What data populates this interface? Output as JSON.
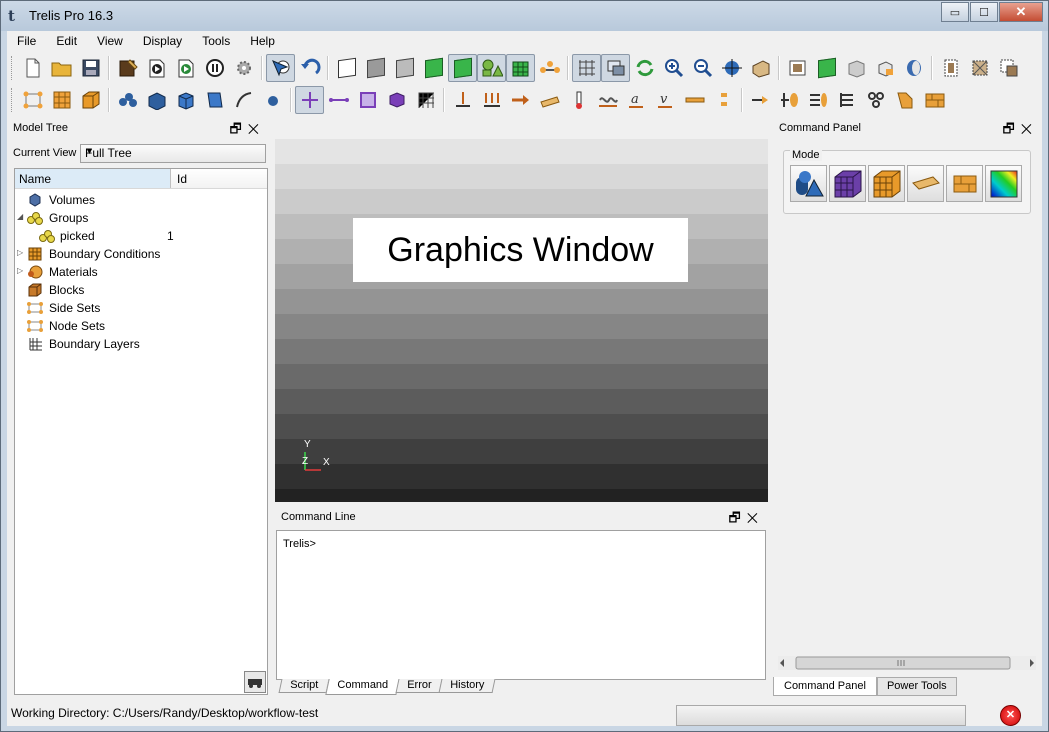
{
  "window": {
    "title": "Trelis Pro  16.3",
    "controls": {
      "minimize": "▭",
      "maximize": "☐",
      "close": "✕"
    }
  },
  "menubar": [
    "File",
    "Edit",
    "View",
    "Display",
    "Tools",
    "Help"
  ],
  "model_tree": {
    "panel_title": "Model Tree",
    "current_view_label": "Current View",
    "current_view_value": "Full Tree",
    "columns": [
      "Name",
      "Id"
    ],
    "items": [
      {
        "label": "Volumes",
        "id": "",
        "icon": "volume-icon"
      },
      {
        "label": "Groups",
        "id": "",
        "icon": "groups-icon",
        "expanded": true
      },
      {
        "label": "picked",
        "id": "1",
        "icon": "group-icon"
      },
      {
        "label": "Boundary Conditions",
        "id": "",
        "icon": "boundary-conditions-icon",
        "collapsed": true
      },
      {
        "label": "Materials",
        "id": "",
        "icon": "materials-icon",
        "collapsed": true
      },
      {
        "label": "Blocks",
        "id": "",
        "icon": "blocks-icon"
      },
      {
        "label": "Side Sets",
        "id": "",
        "icon": "side-sets-icon"
      },
      {
        "label": "Node Sets",
        "id": "",
        "icon": "node-sets-icon"
      },
      {
        "label": "Boundary Layers",
        "id": "",
        "icon": "boundary-layers-icon"
      }
    ]
  },
  "graphics": {
    "label": "Graphics Window",
    "axis_y": "Y",
    "axis_z": "Z",
    "axis_x": "X"
  },
  "command_line": {
    "panel_title": "Command Line",
    "prompt": "Trelis>",
    "tabs": [
      "Script",
      "Command",
      "Error",
      "History"
    ],
    "active_tab": "Command"
  },
  "command_panel": {
    "panel_title": "Command Panel",
    "mode_label": "Mode",
    "mode_buttons": [
      "geometry-mode-icon",
      "mesh-mode-icon",
      "fem-mode-icon",
      "analysis-mode-icon",
      "exodus-mode-icon",
      "results-mode-icon"
    ],
    "tabs": [
      "Command Panel",
      "Power Tools"
    ],
    "active_tab": "Command Panel"
  },
  "status": {
    "working_directory": "Working Directory: C:/Users/Randy/Desktop/workflow-test"
  },
  "colors": {
    "accent": "#5b7fb0",
    "titlebar": "#c3d3e4"
  }
}
